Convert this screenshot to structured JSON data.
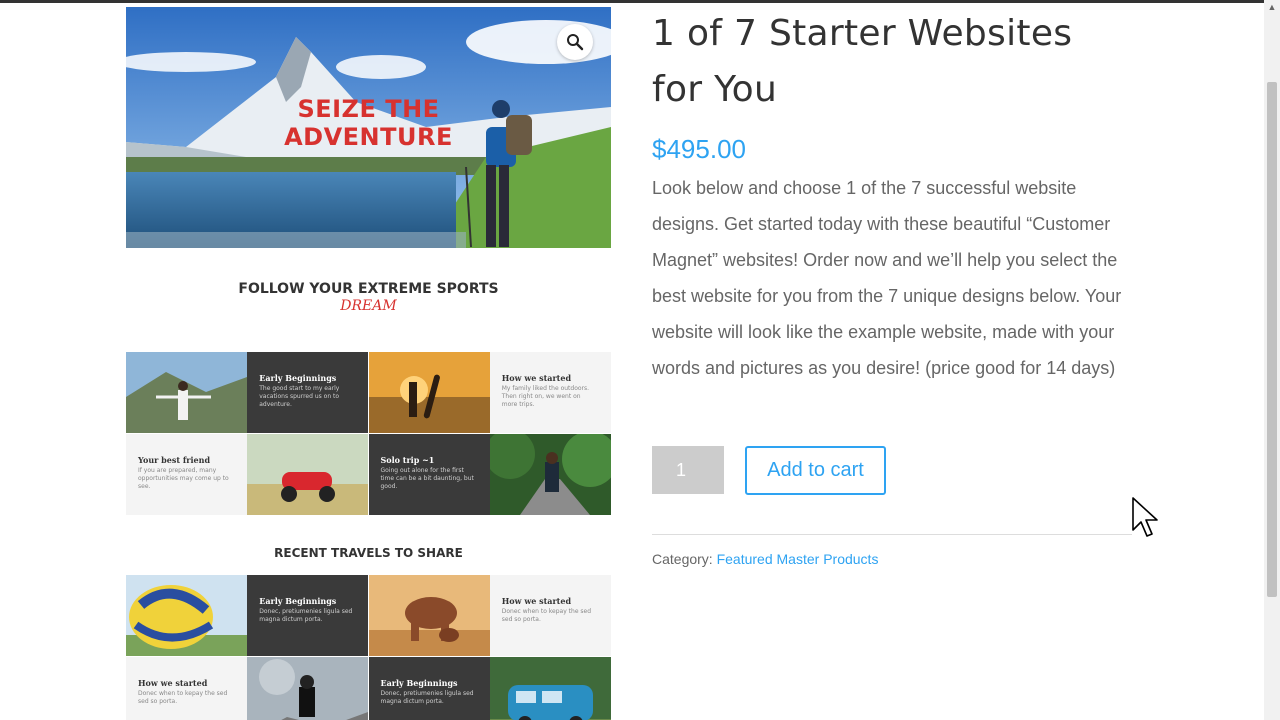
{
  "product": {
    "title": "1 of 7 Starter Websites for You",
    "price": "$495.00",
    "description": "Look below and choose 1 of the 7 successful website designs.  Get started today with these beautiful “Customer Magnet” websites!  Order now and we’ll help you select the best website for you from the 7 unique designs below.  Your website will look like the example website,  made with your words and pictures as you desire!  (price good for 14 days)",
    "quantity": "1",
    "add_to_cart_label": "Add to cart",
    "category_label": "Category:",
    "category_link": "Featured Master Products"
  },
  "gallery": {
    "zoom_icon": "magnifier-icon",
    "hero_title_line1": "SEIZE THE",
    "hero_title_line2": "ADVENTURE",
    "heading_1": "FOLLOW YOUR EXTREME SPORTS",
    "heading_1_script": "DREAM",
    "heading_2": "RECENT TRAVELS TO SHARE",
    "grid_1": [
      {
        "kind": "photo",
        "photo": "mountain-woman"
      },
      {
        "kind": "text-dark",
        "title": "Early Beginnings",
        "body": "The good start to my early vacations spurred us on to adventure."
      },
      {
        "kind": "photo",
        "photo": "surfer-sunset"
      },
      {
        "kind": "text-light",
        "title": "How we started",
        "body": "My family liked the outdoors. Then right on, we went on more trips."
      },
      {
        "kind": "text-light",
        "title": "Your best friend",
        "body": "If you are prepared, many opportunities may come up to see."
      },
      {
        "kind": "photo",
        "photo": "red-scooter"
      },
      {
        "kind": "text-dark",
        "title": "Solo trip ~1",
        "body": "Going out alone for the first time can be a bit daunting, but good."
      },
      {
        "kind": "photo",
        "photo": "forest-bridge"
      }
    ],
    "grid_2": [
      {
        "kind": "photo",
        "photo": "hot-air-balloon"
      },
      {
        "kind": "text-dark",
        "title": "Early Beginnings",
        "body": "Donec, pretiumenies ligula sed magna dictum porta."
      },
      {
        "kind": "photo",
        "photo": "elephants"
      },
      {
        "kind": "text-light",
        "title": "How we started",
        "body": "Donec when to kepay the sed sed so porta."
      },
      {
        "kind": "text-light",
        "title": "How we started",
        "body": "Donec when to kepay the sed sed so porta."
      },
      {
        "kind": "photo",
        "photo": "climber"
      },
      {
        "kind": "text-dark",
        "title": "Early Beginnings",
        "body": "Donec, pretiumenies ligula sed magna dictum porta."
      },
      {
        "kind": "photo",
        "photo": "blue-van"
      }
    ]
  },
  "colors": {
    "accent": "#2ea3f2",
    "hero_title": "#d7322f",
    "text": "#666666",
    "heading": "#333333"
  }
}
